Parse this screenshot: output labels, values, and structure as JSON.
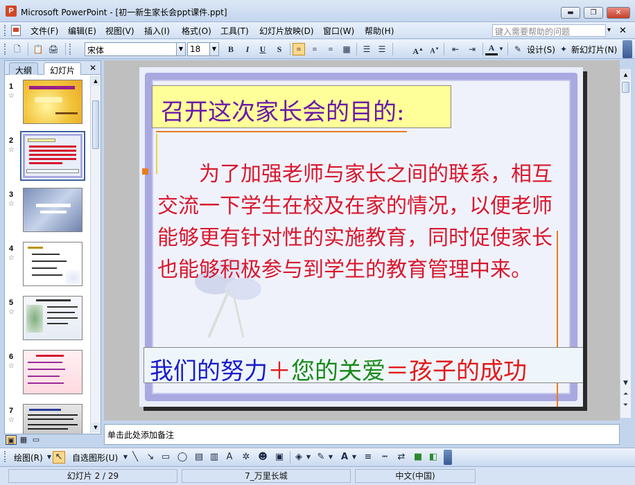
{
  "window": {
    "title": "Microsoft PowerPoint - [初一新生家长会ppt课件.ppt]",
    "app_icon": "P",
    "minimize": "▬",
    "restore": "❐",
    "close": "✕"
  },
  "menu": {
    "items": [
      "文件(F)",
      "编辑(E)",
      "视图(V)",
      "插入(I)",
      "格式(O)",
      "工具(T)",
      "幻灯片放映(D)",
      "窗口(W)",
      "帮助(H)"
    ],
    "help_placeholder": "键入需要帮助的问题",
    "help_dropdown": "▾",
    "doc_close": "✕"
  },
  "toolbar": {
    "font_name": "宋体",
    "font_size": "18",
    "bold": "B",
    "italic": "I",
    "underline": "U",
    "shadow": "S",
    "font_color_label": "A",
    "design_label": "设计(S)",
    "new_slide_label": "新幻灯片(N)"
  },
  "panel": {
    "tab_outline": "大纲",
    "tab_slides": "幻灯片",
    "close": "✕",
    "slide_numbers": [
      "1",
      "2",
      "3",
      "4",
      "5",
      "6",
      "7"
    ],
    "star": "☆",
    "selected_index": 2
  },
  "slide": {
    "title": "召开这次家长会的目的:",
    "body": "为了加强老师与家长之间的联系，相互交流一下学生在校及在家的情况，以便老师能够更有针对性的实施教育，同时促使家长也能够积极参与到学生的教育管理中来。",
    "slogan_parts": [
      {
        "text": "我们的努力",
        "color": "#1c1ccc"
      },
      {
        "text": "＋",
        "color": "#e31b1b"
      },
      {
        "text": "您的关爱",
        "color": "#1a8a1a"
      },
      {
        "text": "＝",
        "color": "#e31b1b"
      },
      {
        "text": "孩子的成功",
        "color": "#e31b1b"
      }
    ]
  },
  "notes": {
    "placeholder": "单击此处添加备注"
  },
  "drawbar": {
    "draw_label": "绘图(R)",
    "autoshapes_label": "自选图形(U)"
  },
  "status": {
    "slide_position": "幻灯片 2 / 29",
    "design_name": "7_万里长城",
    "language": "中文(中国)"
  },
  "colors": {
    "accent_selected": "#3a5ea0",
    "title_purple": "#6a1aa8",
    "body_red": "#d8182e",
    "frame_lavender": "#a9a8e0",
    "title_fill": "#ffff99"
  }
}
